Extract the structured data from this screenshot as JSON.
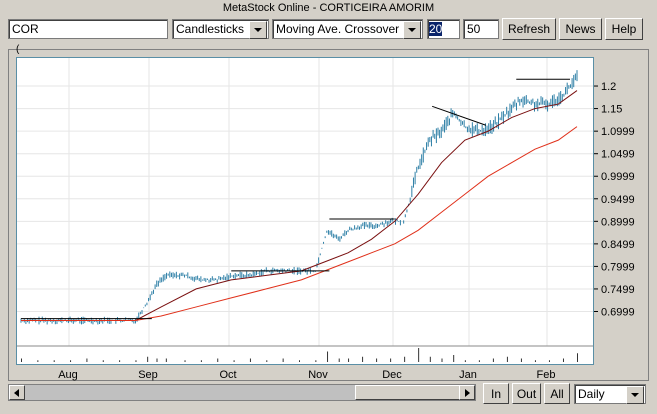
{
  "window_title": "MetaStock Online - CORTICEIRA AMORIM",
  "toolbar": {
    "symbol_value": "COR",
    "chart_style": "Candlesticks",
    "indicator": "Moving Ave. Crossover",
    "period_short": "20",
    "period_long": "50",
    "refresh_label": "Refresh",
    "news_label": "News",
    "help_label": "Help"
  },
  "chart": {
    "corner_mark": "("
  },
  "bottom": {
    "in_label": "In",
    "out_label": "Out",
    "all_label": "All",
    "interval": "Daily"
  },
  "colors": {
    "price_bars": "#2d7fa6",
    "ma_short": "#7a1010",
    "ma_long": "#e0301a",
    "trendlines": "#000000",
    "plot_border": "#5a8fa6"
  },
  "chart_data": {
    "type": "candlestick",
    "x_axis_labels": [
      "Aug",
      "Sep",
      "Oct",
      "Nov",
      "Dec",
      "Jan",
      "Feb"
    ],
    "y_ticks": [
      "1.2",
      "1.15",
      "1.0999",
      "1.0499",
      "0.9999",
      "0.9499",
      "0.8999",
      "0.8499",
      "0.7999",
      "0.7499",
      "0.6999"
    ],
    "y_values": [
      1.2,
      1.15,
      1.0999,
      1.0499,
      0.9999,
      0.9499,
      0.8999,
      0.8499,
      0.7999,
      0.7499,
      0.6999
    ],
    "ylim": [
      0.63,
      1.24
    ],
    "price_series": {
      "x": [
        0,
        7,
        14,
        21,
        28,
        35,
        42,
        49,
        54,
        58,
        62,
        70,
        77,
        84,
        91,
        98,
        105,
        112,
        119,
        126,
        131,
        136,
        140,
        146,
        152,
        158,
        164,
        170,
        175,
        180,
        185,
        190,
        196,
        202,
        208,
        214,
        220,
        226,
        232,
        238
      ],
      "values": [
        0.68,
        0.68,
        0.68,
        0.68,
        0.68,
        0.68,
        0.68,
        0.68,
        0.72,
        0.76,
        0.78,
        0.78,
        0.77,
        0.77,
        0.78,
        0.78,
        0.79,
        0.79,
        0.79,
        0.79,
        0.88,
        0.86,
        0.88,
        0.89,
        0.89,
        0.9,
        0.9,
        1.02,
        1.08,
        1.1,
        1.14,
        1.11,
        1.1,
        1.11,
        1.14,
        1.17,
        1.16,
        1.16,
        1.18,
        1.22
      ]
    },
    "series": [
      {
        "x": [
          0,
          30,
          49,
          60,
          75,
          90,
          105,
          120,
          130,
          140,
          150,
          160,
          170,
          180,
          190,
          200,
          210,
          220,
          230,
          238
        ],
        "values": [
          0.68,
          0.68,
          0.68,
          0.71,
          0.75,
          0.77,
          0.78,
          0.79,
          0.81,
          0.83,
          0.86,
          0.9,
          0.96,
          1.03,
          1.08,
          1.1,
          1.13,
          1.15,
          1.16,
          1.19
        ]
      },
      {
        "x": [
          0,
          30,
          49,
          60,
          75,
          90,
          105,
          120,
          130,
          140,
          150,
          160,
          170,
          180,
          190,
          200,
          210,
          220,
          230,
          238
        ],
        "values": [
          0.68,
          0.68,
          0.68,
          0.69,
          0.71,
          0.73,
          0.75,
          0.77,
          0.79,
          0.81,
          0.83,
          0.85,
          0.88,
          0.92,
          0.96,
          1.0,
          1.03,
          1.06,
          1.08,
          1.11
        ]
      }
    ],
    "volume_values": [
      2,
      1,
      1,
      1,
      2,
      1,
      1,
      1,
      3,
      2,
      2,
      1,
      1,
      2,
      1,
      2,
      1,
      2,
      1,
      1,
      6,
      2,
      2,
      3,
      2,
      2,
      3,
      8,
      3,
      2,
      4,
      1,
      1,
      2,
      3,
      2,
      1,
      1,
      2,
      5
    ]
  }
}
